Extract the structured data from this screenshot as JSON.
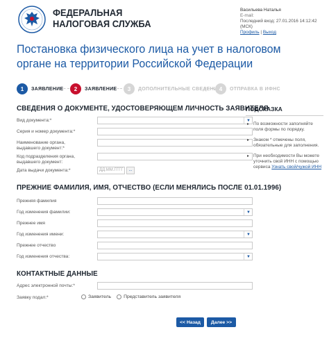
{
  "header": {
    "org_line1": "ФЕДЕРАЛЬНАЯ",
    "org_line2": "НАЛОГОВАЯ СЛУЖБА",
    "user_name": "Васильева Наталья",
    "user_email": "E-mail:",
    "last_login": "Последний вход: 27.01.2016 14:12:42 (МСК)",
    "profile_link": "Профиль",
    "separator": "|",
    "logout_link": "Выход"
  },
  "page_title": "Постановка физического лица на учет в налоговом органе на территории Российской Федерации",
  "steps": [
    {
      "num": "1",
      "label": "ЗАЯВЛЕНИЕ"
    },
    {
      "num": "2",
      "label": "ЗАЯВЛЕНИЕ"
    },
    {
      "num": "3",
      "label": "ДОПОЛНИТЕЛЬНЫЕ СВЕДЕНИЯ"
    },
    {
      "num": "4",
      "label": "ОТПРАВКА В ИФНС"
    }
  ],
  "sections": {
    "doc_title": "СВЕДЕНИЯ О ДОКУМЕНТЕ, УДОСТОВЕРЯЮЩЕМ ЛИЧНОСТЬ ЗАЯВИТЕЛЯ",
    "prev_title": "ПРЕЖНИЕ ФАМИЛИЯ, ИМЯ, ОТЧЕСТВО (ЕСЛИ МЕНЯЛИСЬ ПОСЛЕ 01.01.1996)",
    "contact_title": "КОНТАКТНЫЕ ДАННЫЕ"
  },
  "doc_fields": {
    "doc_type": "Вид документа:*",
    "series_number": "Серия и номер документа:*",
    "issuer_name": "Наименование органа, выдавшего документ:*",
    "issuer_code": "Код подразделения органа, выдавшего документ:",
    "issue_date": "Дата выдачи документа:*",
    "date_placeholder": "ДД.ММ.ГГГГ",
    "date_button": "..."
  },
  "prev_fields": {
    "prev_surname": "Прежняя фамилия",
    "surname_year": "Год изменения фамилии:",
    "prev_name": "Прежнее имя",
    "name_year": "Год изменения имени:",
    "prev_patronymic": "Прежнее отчество",
    "patronymic_year": "Год изменения отчества:"
  },
  "contact_fields": {
    "email": "Адрес электронной почты:*",
    "submitted_by": "Заявку подал:*",
    "opt_applicant": "Заявитель",
    "opt_representative": "Представитель заявителя"
  },
  "hint": {
    "title": "ПОДСКАЗКА",
    "item1": "По возможности заполняйте поля формы по порядку.",
    "item2": "Знаком * отмечены поля, обязательные для заполнения.",
    "item3_text": "При необходимости Вы можете уточнить свой ИНН с помощью сервиса",
    "item3_link": "Узнать свой/чужой ИНН"
  },
  "buttons": {
    "back": "<< Назад",
    "next": "Далее >>"
  },
  "colors": {
    "primary": "#1c5aa5",
    "active_step": "#c8102e",
    "inactive_step": "#d6d6d6"
  }
}
